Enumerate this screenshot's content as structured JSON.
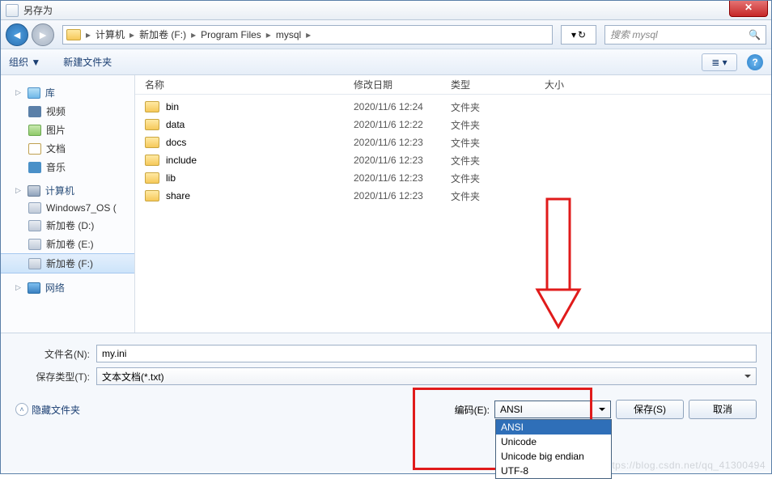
{
  "window": {
    "title": "另存为"
  },
  "nav": {
    "breadcrumbs": [
      "计算机",
      "新加卷 (F:)",
      "Program Files",
      "mysql"
    ],
    "search_placeholder": "搜索 mysql"
  },
  "toolbar": {
    "organize": "组织 ▼",
    "new_folder": "新建文件夹"
  },
  "sidebar": {
    "library": {
      "head": "库",
      "items": [
        "视频",
        "图片",
        "文档",
        "音乐"
      ]
    },
    "computer": {
      "head": "计算机",
      "items": [
        "Windows7_OS (",
        "新加卷 (D:)",
        "新加卷 (E:)",
        "新加卷 (F:)"
      ]
    },
    "network": {
      "head": "网络"
    }
  },
  "columns": {
    "name": "名称",
    "date": "修改日期",
    "type": "类型",
    "size": "大小"
  },
  "rows": [
    {
      "name": "bin",
      "date": "2020/11/6 12:24",
      "type": "文件夹"
    },
    {
      "name": "data",
      "date": "2020/11/6 12:22",
      "type": "文件夹"
    },
    {
      "name": "docs",
      "date": "2020/11/6 12:23",
      "type": "文件夹"
    },
    {
      "name": "include",
      "date": "2020/11/6 12:23",
      "type": "文件夹"
    },
    {
      "name": "lib",
      "date": "2020/11/6 12:23",
      "type": "文件夹"
    },
    {
      "name": "share",
      "date": "2020/11/6 12:23",
      "type": "文件夹"
    }
  ],
  "bottom": {
    "filename_label": "文件名(N):",
    "filename_value": "my.ini",
    "savetype_label": "保存类型(T):",
    "savetype_value": "文本文档(*.txt)",
    "hide_label": "隐藏文件夹",
    "encoding_label": "编码(E):",
    "encoding_value": "ANSI",
    "encoding_options": [
      "ANSI",
      "Unicode",
      "Unicode big endian",
      "UTF-8"
    ],
    "save_label": "保存(S)",
    "cancel_label": "取消"
  },
  "watermark": "https://blog.csdn.net/qq_41300494"
}
